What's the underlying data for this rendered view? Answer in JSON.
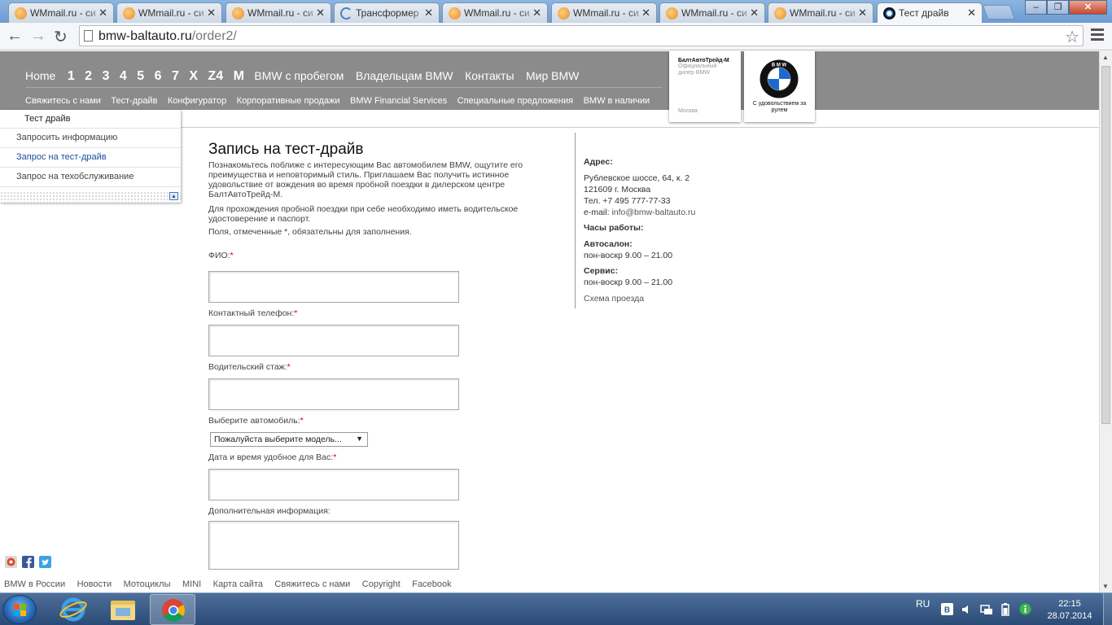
{
  "browser": {
    "tabs": [
      {
        "title": "WMmail.ru - си",
        "icon": "wmmail-icon",
        "active": false
      },
      {
        "title": "WMmail.ru - си",
        "icon": "wmmail-icon",
        "active": false
      },
      {
        "title": "WMmail.ru - си",
        "icon": "wmmail-icon",
        "active": false
      },
      {
        "title": "Трансформер",
        "icon": "loading-icon",
        "active": false
      },
      {
        "title": "WMmail.ru - си",
        "icon": "wmmail-icon",
        "active": false
      },
      {
        "title": "WMmail.ru - си",
        "icon": "wmmail-icon",
        "active": false
      },
      {
        "title": "WMmail.ru - си",
        "icon": "wmmail-icon",
        "active": false
      },
      {
        "title": "WMmail.ru - си",
        "icon": "wmmail-icon",
        "active": false
      },
      {
        "title": "Тест драйв",
        "icon": "bmw-favicon",
        "active": true
      }
    ],
    "url_host": "bmw-baltauto.ru",
    "url_path": "/order2/"
  },
  "nav": {
    "main": [
      "Home"
    ],
    "models": [
      "1",
      "2",
      "3",
      "4",
      "5",
      "6",
      "7",
      "X",
      "Z4",
      "M"
    ],
    "extra": [
      "BMW с пробегом",
      "Владельцам BMW",
      "Контакты",
      "Мир BMW"
    ],
    "sub": [
      "Свяжитесь с нами",
      "Тест-драйв",
      "Конфигуратор",
      "Корпоративные продажи",
      "BMW Financial Services",
      "Специальные предложения",
      "BMW в наличии"
    ]
  },
  "dealer": {
    "name": "БалтАвтоТрейд-М",
    "subtitle": "Официальный дилер BMW",
    "city": "Москва",
    "slogan": "С удовольствием за рулем",
    "logo_text": "B M W"
  },
  "sidebar": {
    "heading": "Тест драйв",
    "items": [
      {
        "label": "Запросить информацию",
        "active": false
      },
      {
        "label": "Запрос на тест-драйв",
        "active": true
      },
      {
        "label": "Запрос на техобслуживание",
        "active": false
      }
    ]
  },
  "content": {
    "title": "Запись на тест-драйв",
    "intro": "Познакомьтесь поближе с интересующим Вас автомобилем BMW, ощутите его преимущества и неповторимый стиль. Приглашаем Вас получить истинное удовольствие от вождения во время пробной поездки в дилерском центре БалтАвтоТрейд-М.",
    "license_note": "Для прохождения пробной поездки при себе необходимо иметь водительское удостоверение и паспорт.",
    "required_note": "Поля, отмеченные *, обязательны для заполнения."
  },
  "form": {
    "required_mark": "*",
    "fio_label": "ФИО:",
    "phone_label": "Контактный телефон:",
    "experience_label": "Водительский стаж:",
    "car_label": "Выберите автомобиль:",
    "car_select_value": "Пожалуйста выберите модель...",
    "datetime_label": "Дата и время удобное для Вас:",
    "extra_label": "Дополнительная информация:"
  },
  "contact": {
    "address_heading": "Адрес:",
    "address_line1": "Рублевское шоссе, 64, к. 2",
    "address_line2": "121609 г. Москва",
    "phone": "Тел. +7 495 777-77-33",
    "email_label": "e-mail:",
    "email": "info@bmw-baltauto.ru",
    "hours_heading": "Часы работы:",
    "showroom_heading": "Автосалон:",
    "showroom_hours": "пон-воскр 9.00 – 21.00",
    "service_heading": "Сервис:",
    "service_hours": "пон-воскр 9.00 – 21.00",
    "map_link": "Схема проезда"
  },
  "footer": {
    "links": [
      "BMW в России",
      "Новости",
      "Мотоциклы",
      "MINI",
      "Карта сайта",
      "Свяжитесь с нами",
      "Copyright",
      "Facebook"
    ]
  },
  "taskbar": {
    "language": "RU",
    "time": "22:15",
    "date": "28.07.2014"
  }
}
